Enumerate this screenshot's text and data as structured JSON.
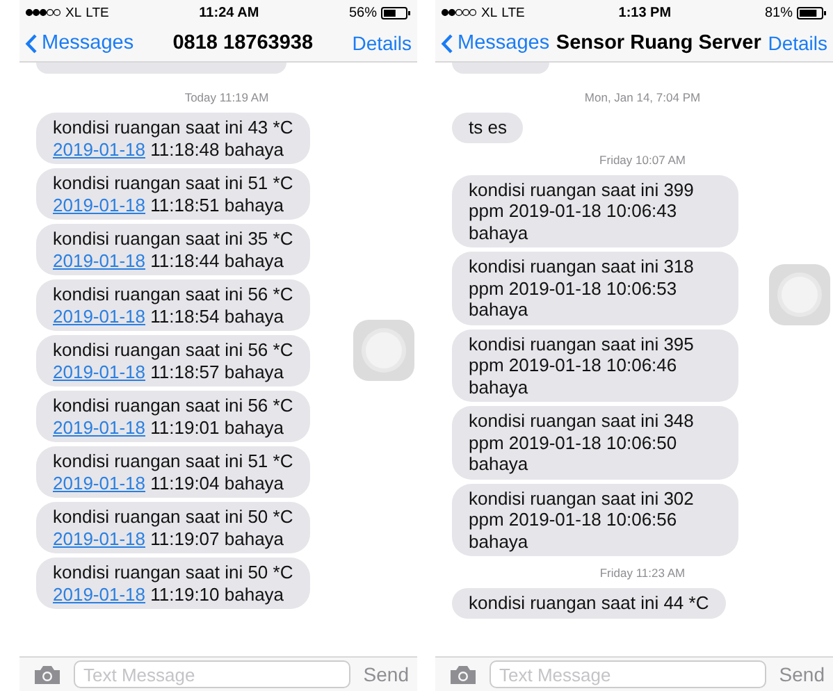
{
  "screens": [
    {
      "status_bar": {
        "carrier": "XL",
        "network": "LTE",
        "time": "11:24 AM",
        "battery": "56%"
      },
      "nav": {
        "back": "Messages",
        "title": "0818 18763938",
        "action": "Details"
      },
      "messages": [
        {
          "kind": "clipped"
        },
        {
          "kind": "timestamp",
          "text": "Today 11:19 AM"
        },
        {
          "kind": "message",
          "text": "kondisi ruangan saat ini 43 *C",
          "link": "2019-01-18",
          "after": "11:18:48 bahaya"
        },
        {
          "kind": "message",
          "text": "kondisi ruangan saat ini 51 *C",
          "link": "2019-01-18",
          "after": "11:18:51 bahaya"
        },
        {
          "kind": "message",
          "text": "kondisi ruangan saat ini 35 *C",
          "link": "2019-01-18",
          "after": "11:18:44 bahaya"
        },
        {
          "kind": "message",
          "text": "kondisi ruangan saat ini 56 *C",
          "link": "2019-01-18",
          "after": "11:18:54 bahaya"
        },
        {
          "kind": "message",
          "text": "kondisi ruangan saat ini 56 *C",
          "link": "2019-01-18",
          "after": "11:18:57 bahaya"
        },
        {
          "kind": "message",
          "text": "kondisi ruangan saat ini 56 *C",
          "link": "2019-01-18",
          "after": "11:19:01 bahaya"
        },
        {
          "kind": "message",
          "text": "kondisi ruangan saat ini 51 *C",
          "link": "2019-01-18",
          "after": "11:19:04 bahaya"
        },
        {
          "kind": "message",
          "text": "kondisi ruangan saat ini 50 *C",
          "link": "2019-01-18",
          "after": "11:19:07 bahaya"
        },
        {
          "kind": "message",
          "text": "kondisi ruangan saat ini 50 *C",
          "link": "2019-01-18",
          "after": "11:19:10 bahaya"
        }
      ],
      "input": {
        "placeholder": "Text Message",
        "send": "Send"
      }
    },
    {
      "status_bar": {
        "carrier": "XL",
        "network": "LTE",
        "time": "1:13 PM",
        "battery": "81%"
      },
      "nav": {
        "back": "Messages",
        "title": "Sensor Ruang Server",
        "action": "Details"
      },
      "messages": [
        {
          "kind": "clipped"
        },
        {
          "kind": "timestamp",
          "text": "Mon, Jan 14, 7:04 PM"
        },
        {
          "kind": "message",
          "text": "ts es"
        },
        {
          "kind": "timestamp",
          "text": "Friday 10:07 AM"
        },
        {
          "kind": "message",
          "text": "kondisi ruangan saat ini 399 ppm 2019-01-18 10:06:43 bahaya"
        },
        {
          "kind": "message",
          "text": "kondisi ruangan saat ini 318 ppm 2019-01-18 10:06:53 bahaya"
        },
        {
          "kind": "message",
          "text": "kondisi ruangan saat ini 395 ppm 2019-01-18 10:06:46 bahaya"
        },
        {
          "kind": "message",
          "text": "kondisi ruangan saat ini 348 ppm 2019-01-18 10:06:50 bahaya"
        },
        {
          "kind": "message",
          "text": "kondisi ruangan saat ini 302 ppm 2019-01-18 10:06:56 bahaya"
        },
        {
          "kind": "timestamp",
          "text": "Friday 11:23 AM"
        },
        {
          "kind": "message",
          "text": "kondisi ruangan saat ini 44 *C"
        }
      ],
      "input": {
        "placeholder": "Text Message",
        "send": "Send"
      }
    }
  ]
}
